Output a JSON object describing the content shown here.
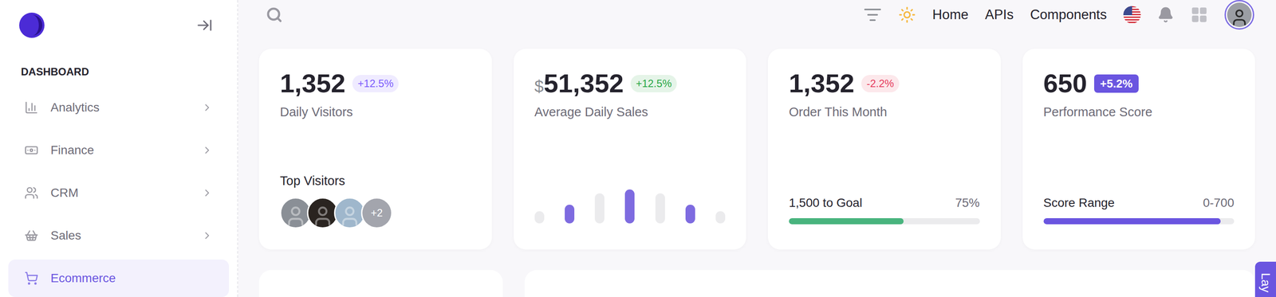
{
  "sidebar": {
    "section": "DASHBOARD",
    "items": [
      {
        "label": "Analytics",
        "selected": false
      },
      {
        "label": "Finance",
        "selected": false
      },
      {
        "label": "CRM",
        "selected": false
      },
      {
        "label": "Sales",
        "selected": false
      },
      {
        "label": "Ecommerce",
        "selected": true
      }
    ]
  },
  "header": {
    "links": [
      "Home",
      "APIs",
      "Components"
    ]
  },
  "cards": [
    {
      "kind": "visitors",
      "value": "1,352",
      "currency": "",
      "label": "Daily Visitors",
      "badge": {
        "text": "+12.5%",
        "kind": "soft",
        "color": "#7c5cfc"
      },
      "footer_title": "Top Visitors",
      "avatars": [
        {
          "color": "#8a8f96"
        },
        {
          "color": "#2a2420"
        },
        {
          "color": "#9fb7cc"
        }
      ],
      "more": "+2"
    },
    {
      "kind": "chart",
      "value": "51,352",
      "currency": "$",
      "label": "Average Daily Sales",
      "badge": {
        "text": "+12.5%",
        "kind": "soft",
        "color": "#28a745"
      },
      "bars": [
        {
          "value": 28,
          "color": "#ebebed"
        },
        {
          "value": 43,
          "color": "#7e6be0"
        },
        {
          "value": 69,
          "color": "#ebebed"
        },
        {
          "value": 78,
          "color": "#7e6be0"
        },
        {
          "value": 69,
          "color": "#ebebed"
        },
        {
          "value": 43,
          "color": "#7e6be0"
        },
        {
          "value": 28,
          "color": "#ebebed"
        }
      ]
    },
    {
      "kind": "progress",
      "value": "1,352",
      "currency": "",
      "label": "Order This Month",
      "badge": {
        "text": "-2.2%",
        "kind": "soft",
        "color": "#e53e5e"
      },
      "progress": {
        "title": "1,500 to Goal",
        "reading": "75%",
        "level": 0.6,
        "color": "#48b47e"
      }
    },
    {
      "kind": "progress",
      "value": "650",
      "currency": "",
      "label": "Performance Score",
      "badge": {
        "text": "+5.2%",
        "kind": "solid",
        "color": "#6a55e0"
      },
      "progress": {
        "title": "Score Range",
        "reading": "0-700",
        "level": 0.93,
        "color": "#6a55e0"
      }
    }
  ],
  "layout_tab": {
    "label": "Lay"
  }
}
